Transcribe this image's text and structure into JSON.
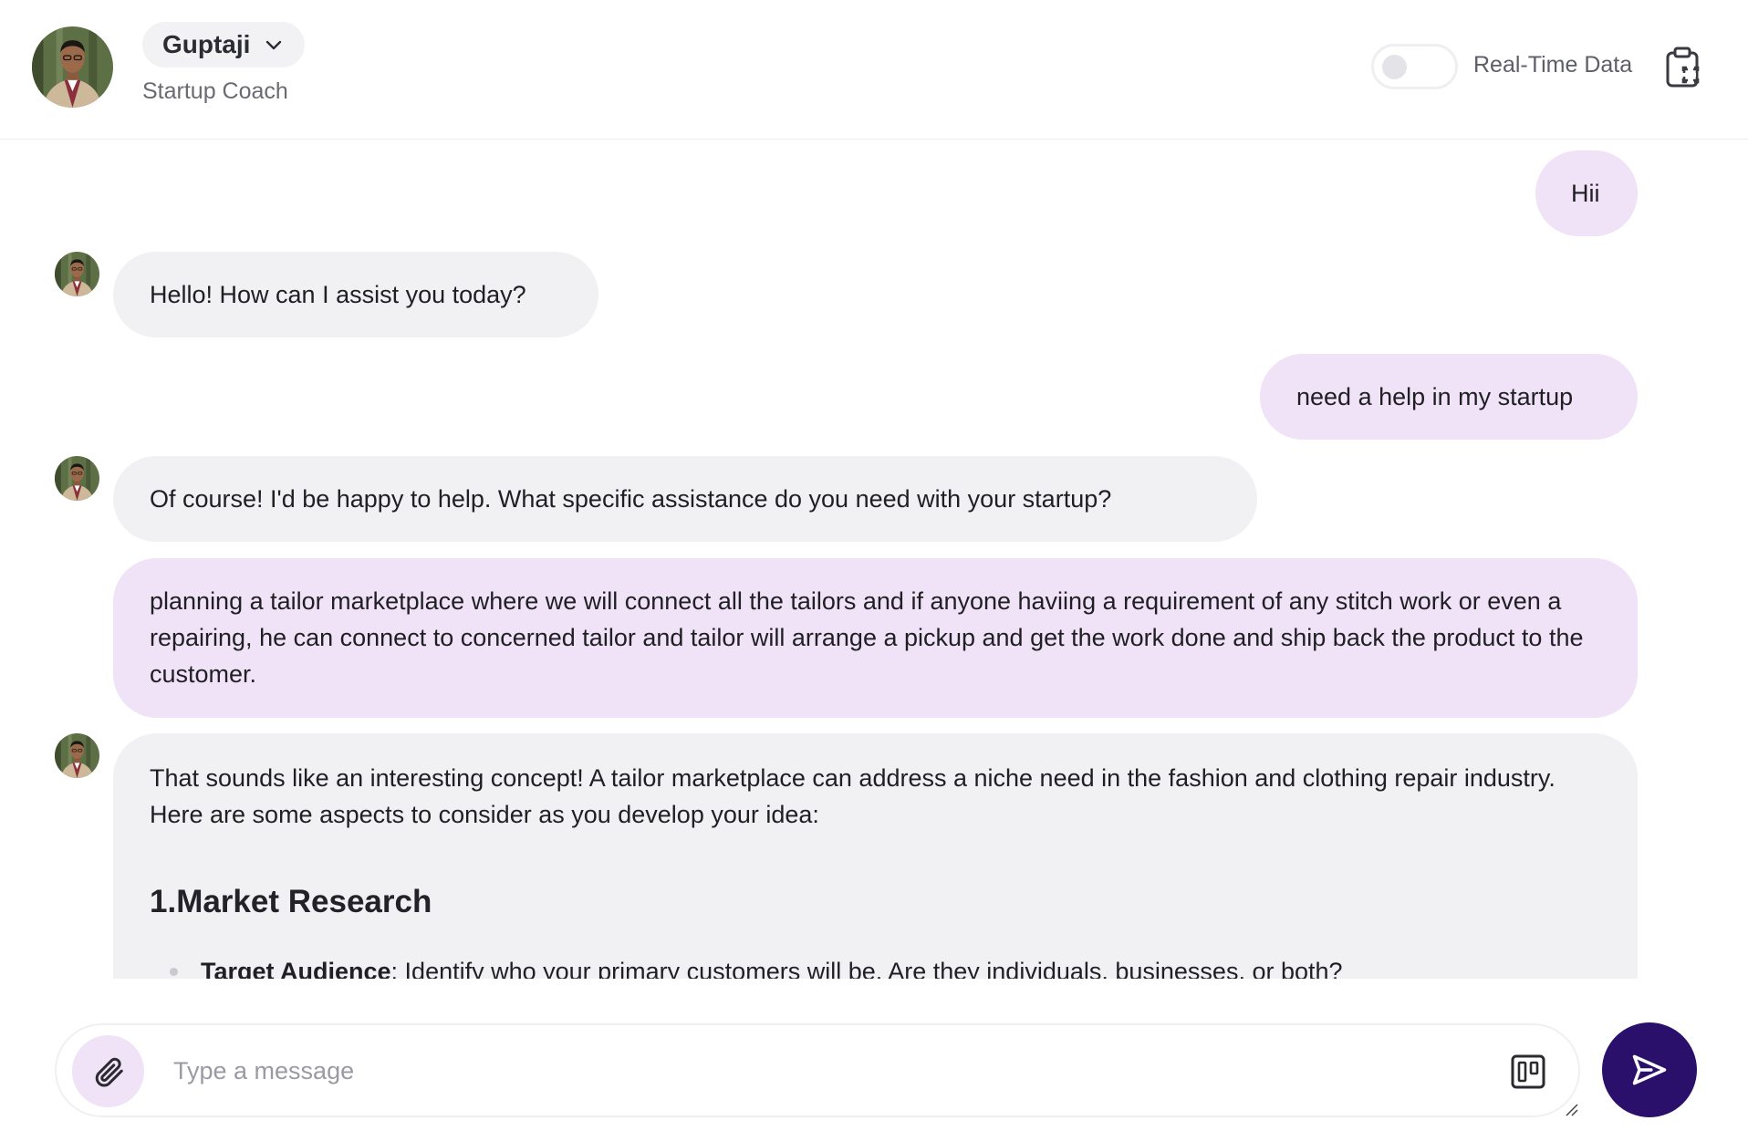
{
  "header": {
    "persona_name": "Guptaji",
    "persona_role": "Startup Coach",
    "toggle_label": "Real-Time Data",
    "toggle_on": false
  },
  "messages": [
    {
      "role": "user",
      "text": "Hii"
    },
    {
      "role": "assistant",
      "text": "Hello! How can I assist you today?"
    },
    {
      "role": "user",
      "text": "need a help in my startup"
    },
    {
      "role": "assistant",
      "text": "Of course! I'd be happy to help. What specific assistance do you need with your startup?"
    },
    {
      "role": "user",
      "text": "planning a tailor marketplace where we will connect all the tailors and if anyone haviing a requirement of any stitch work or even a repairing, he can connect to concerned tailor and tailor will arrange a pickup and get the work done and ship back the product to the customer."
    },
    {
      "role": "assistant",
      "intro": "That sounds like an interesting concept! A tailor marketplace can address a niche need in the fashion and clothing repair industry. Here are some aspects to consider as you develop your idea:",
      "heading": "1.Market Research",
      "bullets": [
        {
          "term": "Target Audience",
          "text": ": Identify who your primary customers will be. Are they individuals, businesses, or both?"
        }
      ]
    }
  ],
  "composer": {
    "placeholder": "Type a message",
    "value": ""
  },
  "icons": {
    "header_chevron": "chevron-down-icon",
    "clipboard": "clipboard-scan-icon",
    "attach": "paperclip-icon",
    "board": "kanban-board-icon",
    "send": "send-icon"
  },
  "colors": {
    "user_bubble": "#f0e2f7",
    "assistant_bubble": "#f1f1f3",
    "send_button": "#2a0f6b",
    "attach_button": "#f0e2f7"
  }
}
